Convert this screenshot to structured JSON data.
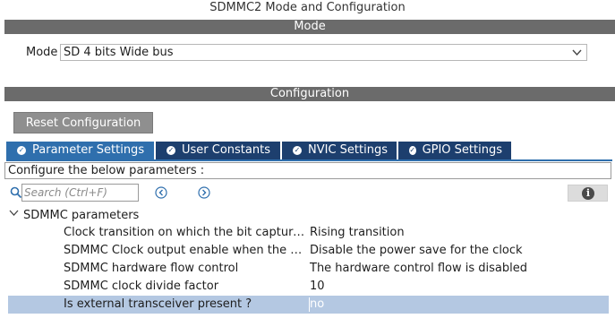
{
  "window": {
    "title": "SDMMC2 Mode and Configuration"
  },
  "mode_section": {
    "header": "Mode",
    "label": "Mode",
    "value": "SD 4 bits Wide bus"
  },
  "config_section": {
    "header": "Configuration",
    "reset_button": "Reset Configuration",
    "tabs": [
      {
        "label": "Parameter Settings",
        "icon": "check-circle-icon"
      },
      {
        "label": "User Constants",
        "icon": "check-circle-icon"
      },
      {
        "label": "NVIC Settings",
        "icon": "check-circle-icon"
      },
      {
        "label": "GPIO Settings",
        "icon": "check-circle-icon"
      }
    ],
    "instruction": "Configure the below parameters :",
    "search": {
      "placeholder": "Search (Ctrl+F)",
      "value": ""
    },
    "group": {
      "label": "SDMMC parameters"
    },
    "parameters": [
      {
        "name": "Clock transition on which the bit capture ...",
        "value": "Rising transition"
      },
      {
        "name": "SDMMC Clock output enable when the b...",
        "value": "Disable the power save for the clock"
      },
      {
        "name": "SDMMC hardware flow control",
        "value": "The hardware control flow is disabled"
      },
      {
        "name": "SDMMC clock divide factor",
        "value": "10"
      },
      {
        "name": "Is external transceiver present ?",
        "value": "no"
      }
    ]
  },
  "colors": {
    "section_bar": "#6b6b6b",
    "tab_active": "#2f6fad",
    "tab_inactive": "#1d3f6e",
    "selected_row": "#b4c8e2"
  }
}
